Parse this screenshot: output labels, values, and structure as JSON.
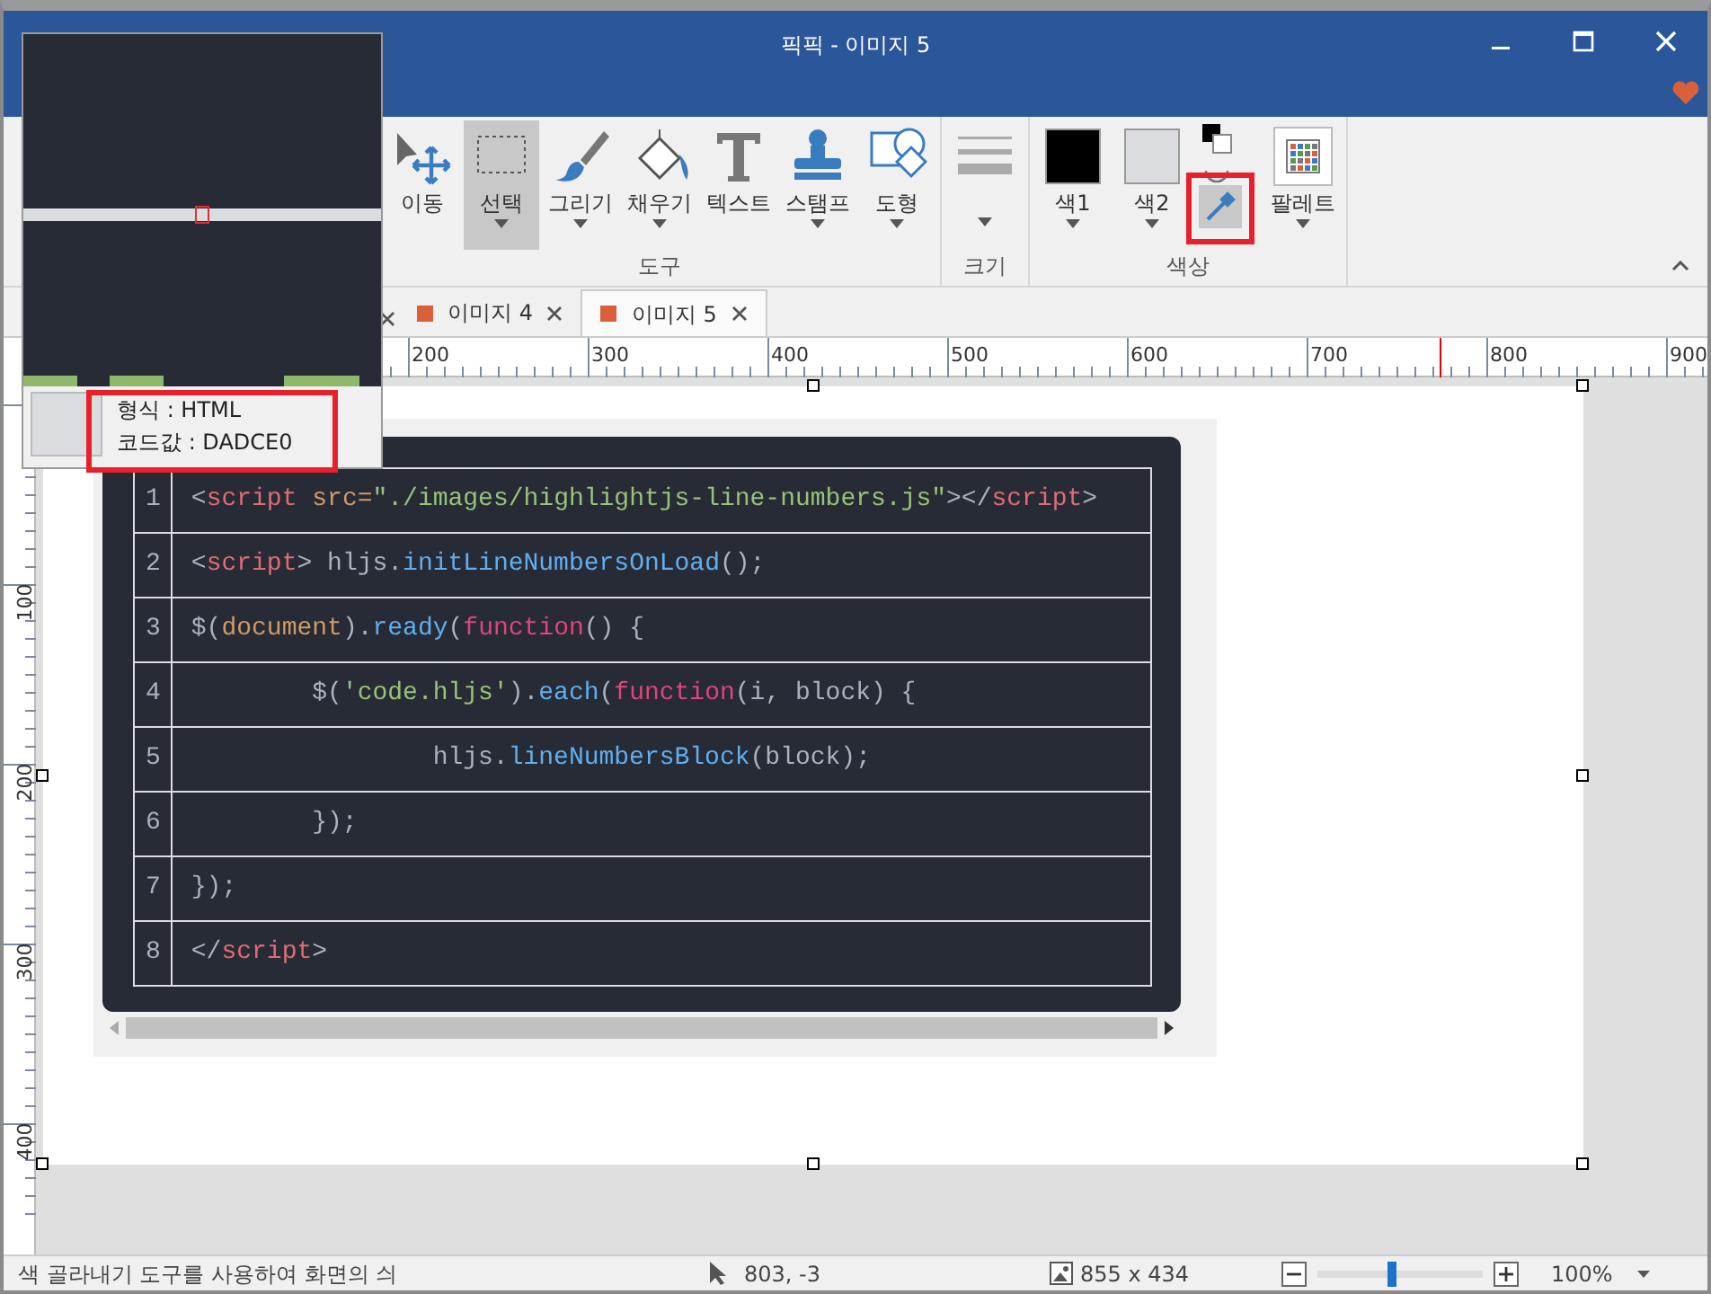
{
  "window": {
    "title": "픽픽 - 이미지 5"
  },
  "ribbon": {
    "groups": [
      {
        "label": "도구",
        "tools": [
          {
            "kind": "move",
            "label": "이동",
            "selected": false,
            "dropdown": false
          },
          {
            "kind": "select",
            "label": "선택",
            "selected": true,
            "dropdown": true
          },
          {
            "kind": "draw",
            "label": "그리기",
            "selected": false,
            "dropdown": true
          },
          {
            "kind": "fill",
            "label": "채우기",
            "selected": false,
            "dropdown": true
          },
          {
            "kind": "text",
            "label": "텍스트",
            "selected": false,
            "dropdown": false
          },
          {
            "kind": "stamp",
            "label": "스탬프",
            "selected": false,
            "dropdown": true
          },
          {
            "kind": "shape",
            "label": "도형",
            "selected": false,
            "dropdown": true
          }
        ]
      },
      {
        "label": "크기",
        "tools": [
          {
            "kind": "size",
            "selected": false,
            "dropdown": true
          }
        ]
      },
      {
        "label": "색상",
        "tools": [
          {
            "kind": "color1",
            "label": "색1",
            "selected": false,
            "dropdown": true
          },
          {
            "kind": "color2",
            "label": "색2",
            "selected": false,
            "dropdown": true
          },
          {
            "kind": "eyedropper",
            "selected": true,
            "dropdown": false
          },
          {
            "kind": "palette",
            "label": "팔레트",
            "selected": false,
            "dropdown": true
          }
        ]
      }
    ]
  },
  "tabs": [
    {
      "label": "이미지 4",
      "selected": false
    },
    {
      "label": "이미지 5",
      "selected": true
    }
  ],
  "top_ruler": [
    "200",
    "300",
    "400",
    "500",
    "600",
    "700",
    "800",
    "900"
  ],
  "left_ruler": [
    "100",
    "200",
    "300",
    "400"
  ],
  "code_lines": [
    {
      "number": "1",
      "tokens": [
        {
          "text": "<",
          "kind": "plain"
        },
        {
          "text": "script",
          "kind": "tag"
        },
        {
          "text": " src=",
          "kind": "attr"
        },
        {
          "text": "\"./images/highlightjs-line-numbers.js\"",
          "kind": "string"
        },
        {
          "text": "></",
          "kind": "plain"
        },
        {
          "text": "script",
          "kind": "tag"
        },
        {
          "text": ">",
          "kind": "plain"
        }
      ]
    },
    {
      "number": "2",
      "tokens": [
        {
          "text": "<",
          "kind": "plain"
        },
        {
          "text": "script",
          "kind": "tag"
        },
        {
          "text": "> hljs.",
          "kind": "plain"
        },
        {
          "text": "initLineNumbersOnLoad",
          "kind": "func"
        },
        {
          "text": "();",
          "kind": "plain"
        }
      ]
    },
    {
      "number": "3",
      "tokens": [
        {
          "text": "$(",
          "kind": "plain"
        },
        {
          "text": "document",
          "kind": "builtin"
        },
        {
          "text": ").",
          "kind": "plain"
        },
        {
          "text": "ready",
          "kind": "func"
        },
        {
          "text": "(",
          "kind": "plain"
        },
        {
          "text": "function",
          "kind": "keyword"
        },
        {
          "text": "() {",
          "kind": "plain"
        }
      ]
    },
    {
      "number": "4",
      "tokens": [
        {
          "text": "        $(",
          "kind": "plain"
        },
        {
          "text": "'code.hljs'",
          "kind": "string"
        },
        {
          "text": ").",
          "kind": "plain"
        },
        {
          "text": "each",
          "kind": "func"
        },
        {
          "text": "(",
          "kind": "plain"
        },
        {
          "text": "function",
          "kind": "keyword"
        },
        {
          "text": "(i, block) {",
          "kind": "plain"
        }
      ]
    },
    {
      "number": "5",
      "tokens": [
        {
          "text": "                hljs.",
          "kind": "plain"
        },
        {
          "text": "lineNumbersBlock",
          "kind": "func"
        },
        {
          "text": "(block);",
          "kind": "plain"
        }
      ]
    },
    {
      "number": "6",
      "tokens": [
        {
          "text": "        });",
          "kind": "plain"
        }
      ]
    },
    {
      "number": "7",
      "tokens": [
        {
          "text": "});",
          "kind": "plain"
        }
      ]
    },
    {
      "number": "8",
      "tokens": [
        {
          "text": "</",
          "kind": "plain"
        },
        {
          "text": "script",
          "kind": "tag"
        },
        {
          "text": ">",
          "kind": "plain"
        }
      ]
    }
  ],
  "magnifier": {
    "format": "형식 : HTML",
    "code_value": "코드값 : DADCE0"
  },
  "status_bar": {
    "message": "색 골라내기 도구를 사용하여 화면의 싀",
    "cursor": "803, -3",
    "image_size": "855 x 434",
    "zoom_slider": {
      "level": 0.45
    },
    "zoom": "100%"
  }
}
